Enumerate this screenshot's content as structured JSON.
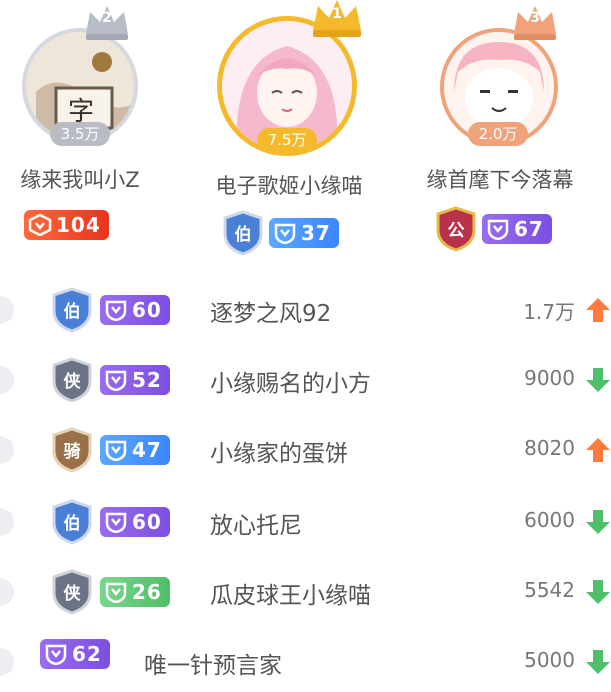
{
  "podium": [
    {
      "rank": "2",
      "score": "3.5万",
      "name": "缘来我叫小Z",
      "level": "104",
      "level_color": "red",
      "rank_badge": ""
    },
    {
      "rank": "1",
      "score": "7.5万",
      "name": "电子歌姬小缘喵",
      "level": "37",
      "level_color": "blue",
      "rank_badge": "伯"
    },
    {
      "rank": "3",
      "score": "2.0万",
      "name": "缘首麾下今落幕",
      "level": "67",
      "level_color": "purple",
      "rank_badge": "公"
    }
  ],
  "list": [
    {
      "rank_badge": "伯",
      "level": "60",
      "level_color": "purple",
      "name": "逐梦之风92",
      "score": "1.7万",
      "trend": "up"
    },
    {
      "rank_badge": "侠",
      "level": "52",
      "level_color": "purple",
      "name": "小缘赐名的小方",
      "score": "9000",
      "trend": "down"
    },
    {
      "rank_badge": "骑",
      "level": "47",
      "level_color": "blue",
      "name": "小缘家的蛋饼",
      "score": "8020",
      "trend": "up"
    },
    {
      "rank_badge": "伯",
      "level": "60",
      "level_color": "purple",
      "name": "放心托尼",
      "score": "6000",
      "trend": "down"
    },
    {
      "rank_badge": "侠",
      "level": "26",
      "level_color": "green",
      "name": "瓜皮球王小缘喵",
      "score": "5542",
      "trend": "down"
    },
    {
      "rank_badge": "",
      "level": "62",
      "level_color": "purple",
      "name": "唯一针预言家",
      "score": "5000",
      "trend": "down"
    }
  ],
  "colors": {
    "gold": "#f5b92c",
    "silver": "#b8bcc6",
    "bronze": "#f0a27a",
    "up": "#ff7a3d",
    "down": "#4fbf69"
  }
}
